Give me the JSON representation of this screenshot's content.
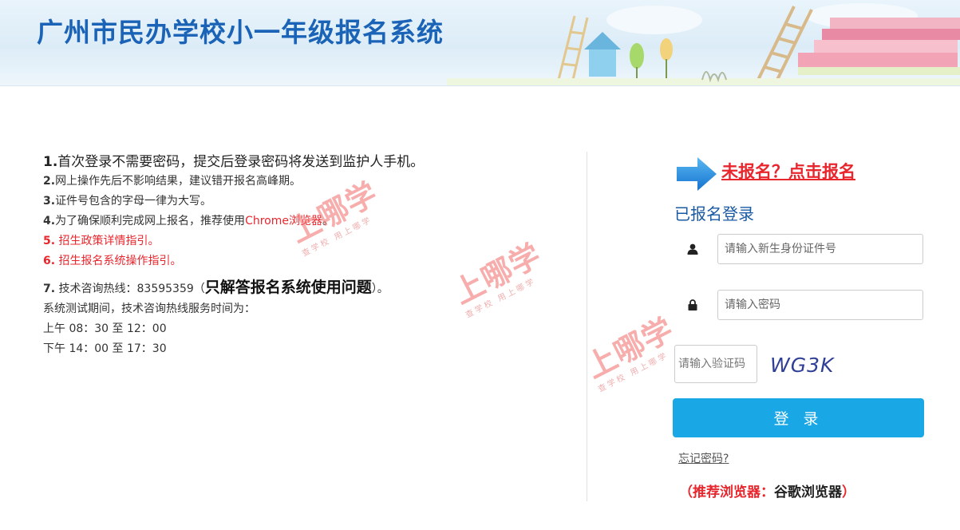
{
  "header": {
    "title": "广州市民办学校小一年级报名系统"
  },
  "notice": {
    "line1": {
      "num": "1.",
      "text": "首次登录不需要密码，提交后登录密码将发送到监护人手机。"
    },
    "line2": {
      "num": "2.",
      "text": "网上操作先后不影响结果，建议错开报名高峰期。"
    },
    "line3": {
      "num": "3.",
      "text": "证件号包含的字母一律为大写。"
    },
    "line4": {
      "num": "4.",
      "text": "为了确保顺利完成网上报名，推荐使用",
      "highlight": "Chrome浏览器",
      "end": "。"
    },
    "line5": {
      "num": "5.",
      "text": "招生政策详情指引",
      "end": "。"
    },
    "line6": {
      "num": "6.",
      "text": "招生报名系统操作指引",
      "end": "。"
    },
    "line7": {
      "num": "7.",
      "text": "技术咨询热线：83595359（",
      "bold": "只解答报名系统使用问题",
      "end": "）。"
    },
    "hours_intro": "系统测试期间，技术咨询热线服务时间为：",
    "hours_am": "上午 08：30 至 12：00",
    "hours_pm": "下午 14：00 至 17：30"
  },
  "login": {
    "signup_link": "未报名？点击报名",
    "title": "已报名登录",
    "id_placeholder": "请输入新生身份证件号",
    "password_placeholder": "请输入密码",
    "captcha_placeholder": "请输入验证码",
    "captcha_text": "WG3K",
    "submit_label": "登 录",
    "forgot_label": "忘记密码?",
    "recommend_prefix": "（推荐浏览器：",
    "recommend_browser": "谷歌浏览器",
    "recommend_suffix": "）"
  },
  "watermark": {
    "main": "上哪学",
    "sub": "查学校 用上哪学"
  },
  "colors": {
    "title_blue": "#1a63b7",
    "alert_red": "#e8262d",
    "button_blue": "#1aa7e6",
    "login_title_blue": "#1a5aa3"
  },
  "icons": [
    "arrow-right-icon",
    "user-icon",
    "lock-icon"
  ]
}
